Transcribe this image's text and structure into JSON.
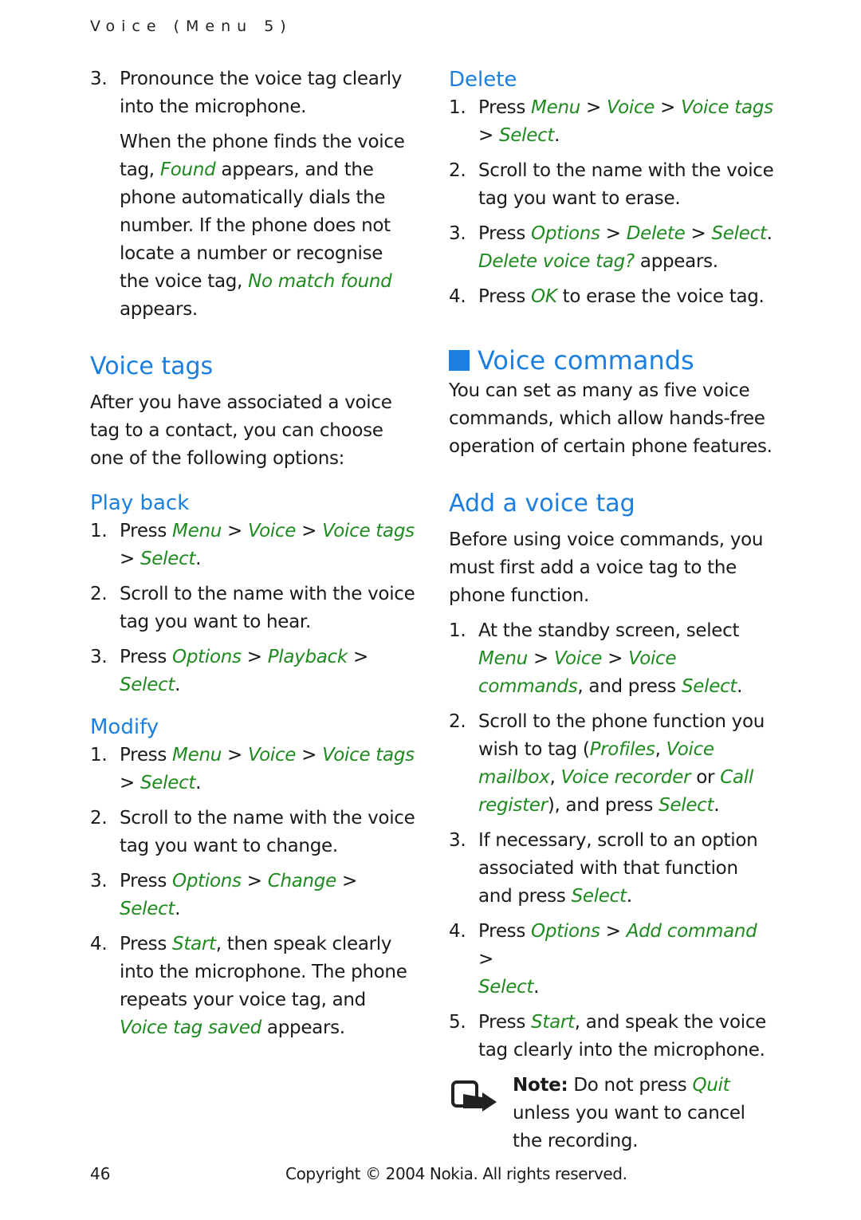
{
  "running_head": "Voice (Menu 5)",
  "left_column": {
    "intro_step": {
      "num": "3.",
      "text": "Pronounce the voice tag clearly into the microphone."
    },
    "intro_para": {
      "t1": "When the phone finds the voice tag, ",
      "found": "Found",
      "t2": " appears, and the phone automatically dials the number. If the phone does not locate a number or recognise the voice tag, ",
      "no_match": "No match found",
      "t3": " appears."
    },
    "voice_tags": {
      "heading": "Voice tags",
      "body": "After you have associated a voice tag to a contact, you can choose one of the following options:"
    },
    "play_back": {
      "heading": "Play back",
      "steps": [
        {
          "num": "1.",
          "pre": "Press ",
          "a": "Menu",
          "s1": " > ",
          "b": "Voice",
          "s2": " > ",
          "c": "Voice tags",
          "s3": " > ",
          "d": "Select",
          "end": "."
        },
        {
          "num": "2.",
          "text": "Scroll to the name with the voice tag you want to hear."
        },
        {
          "num": "3.",
          "pre": "Press ",
          "a": "Options",
          "s1": " > ",
          "b": "Playback",
          "s2": " > ",
          "c": "Select",
          "end": "."
        }
      ]
    },
    "modify": {
      "heading": "Modify",
      "steps": [
        {
          "num": "1.",
          "pre": "Press ",
          "a": "Menu",
          "s1": " > ",
          "b": "Voice",
          "s2": " > ",
          "c": "Voice tags",
          "s3": " > ",
          "d": "Select",
          "end": "."
        },
        {
          "num": "2.",
          "text": "Scroll to the name with the voice tag you want to change."
        },
        {
          "num": "3.",
          "pre": "Press ",
          "a": "Options",
          "s1": " > ",
          "b": "Change",
          "s2": " > ",
          "c": "Select",
          "end": "."
        },
        {
          "num": "4.",
          "pre": "Press ",
          "a": "Start",
          "t1": ", then speak clearly into the microphone. The phone repeats your voice tag, and ",
          "b": "Voice tag saved",
          "t2": " appears."
        }
      ]
    }
  },
  "right_column": {
    "delete": {
      "heading": "Delete",
      "steps": [
        {
          "num": "1.",
          "pre": "Press ",
          "a": "Menu",
          "s1": " > ",
          "b": "Voice",
          "s2": " > ",
          "c": "Voice tags",
          "s3": " > ",
          "d": "Select",
          "end": "."
        },
        {
          "num": "2.",
          "text": "Scroll to the name with the voice tag you want to erase."
        },
        {
          "num": "3.",
          "pre": "Press ",
          "a": "Options",
          "s1": " > ",
          "b": "Delete",
          "s2": " > ",
          "c": "Select",
          "end": ". ",
          "d": "Delete voice tag?",
          "t2": " appears."
        },
        {
          "num": "4.",
          "pre": "Press ",
          "a": "OK",
          "t1": " to erase the voice tag."
        }
      ]
    },
    "voice_commands": {
      "heading": "Voice commands",
      "body": "You can set as many as five voice commands, which allow hands-free operation of certain phone features."
    },
    "add_voice_tag": {
      "heading": "Add a voice tag",
      "body": "Before using voice commands, you must first add a voice tag to the phone function.",
      "steps": [
        {
          "num": "1.",
          "pre": "At the standby screen, select ",
          "a": "Menu",
          "s1": " > ",
          "b": "Voice",
          "s2": " > ",
          "c": "Voice commands",
          "t1": ", and press ",
          "d": "Select",
          "end": "."
        },
        {
          "num": "2.",
          "pre": "Scroll to the phone function you wish to tag (",
          "a": "Profiles",
          "s1": ", ",
          "b": "Voice mailbox",
          "s2": ", ",
          "c": "Voice recorder",
          "t1": " or ",
          "d": "Call register",
          "t2": "), and press ",
          "e": "Select",
          "end": "."
        },
        {
          "num": "3.",
          "pre": "If necessary, scroll to an option associated with that function and press ",
          "a": "Select",
          "end": "."
        },
        {
          "num": "4.",
          "pre": "Press ",
          "a": "Options",
          "s1": " > ",
          "b": "Add command",
          "s2": " > ",
          "c": "Select",
          "end": "."
        },
        {
          "num": "5.",
          "pre": "Press ",
          "a": "Start",
          "t1": ", and speak the voice tag clearly into the microphone."
        }
      ]
    },
    "note": {
      "icon": "note-icon",
      "label": "Note:",
      "t1": " Do not press ",
      "quit": "Quit",
      "t2": " unless you want to cancel the recording."
    }
  },
  "footer": {
    "page_number": "46",
    "copyright": "Copyright © 2004 Nokia. All rights reserved."
  },
  "colors": {
    "heading_blue": "#1a7fe0",
    "menu_green": "#1f8a1f",
    "text": "#1a1a1a"
  }
}
